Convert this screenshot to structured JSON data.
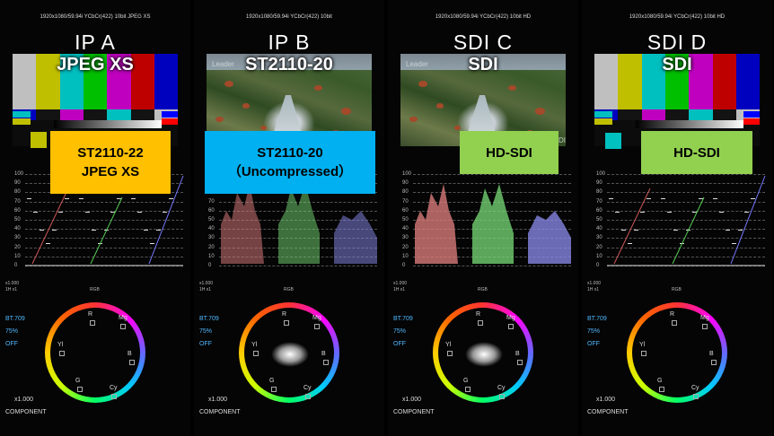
{
  "panels": [
    {
      "resolution": "1920x1080/59.94i YCbCr(422) 10bit JPEG XS",
      "source": "IP A",
      "label": "JPEG XS",
      "callout": [
        "ST2110-22",
        "JPEG XS"
      ],
      "callout_color": "#ffc000",
      "callout_text_color": "#000000",
      "type": "bars"
    },
    {
      "resolution": "1920x1080/59.94i YCbCr(422) 10bit",
      "source": "IP B",
      "label": "ST2110-20",
      "callout": [
        "ST2110-20",
        "（Uncompressed）"
      ],
      "callout_color": "#00b0f0",
      "callout_text_color": "#000000",
      "type": "photo"
    },
    {
      "resolution": "1920x1080/59.94i YCbCr(422) 10bit HD",
      "source": "SDI C",
      "label": "SDI",
      "callout": [
        "HD-SDI"
      ],
      "callout_color": "#92d050",
      "callout_text_color": "#000000",
      "type": "photo"
    },
    {
      "resolution": "1920x1080/59.94i YCbCr(422) 10bit HD",
      "source": "SDI D",
      "label": "SDI",
      "callout": [
        "HD-SDI"
      ],
      "callout_color": "#92d050",
      "callout_text_color": "#000000",
      "type": "bars"
    }
  ],
  "watermark": "Leader",
  "watermark_corner": "DI",
  "waveform": {
    "scale": [
      "100",
      "90",
      "80",
      "70",
      "60",
      "50",
      "40",
      "30",
      "20",
      "10",
      "0"
    ],
    "gain": "x1.000",
    "sweep": "1H x1",
    "mode": "RGB"
  },
  "vectorscope": {
    "colorimetry": "BT.709",
    "saturation": "75%",
    "state": "OFF",
    "gain": "x1.000",
    "mode": "COMPONENT",
    "targets": [
      "R",
      "Mg",
      "B",
      "Cy",
      "G",
      "Yl"
    ]
  },
  "colors": {
    "callout_yellow": "#ffc000",
    "callout_blue": "#00b0f0",
    "callout_green": "#92d050",
    "scope_info": "#4fb8ff"
  }
}
